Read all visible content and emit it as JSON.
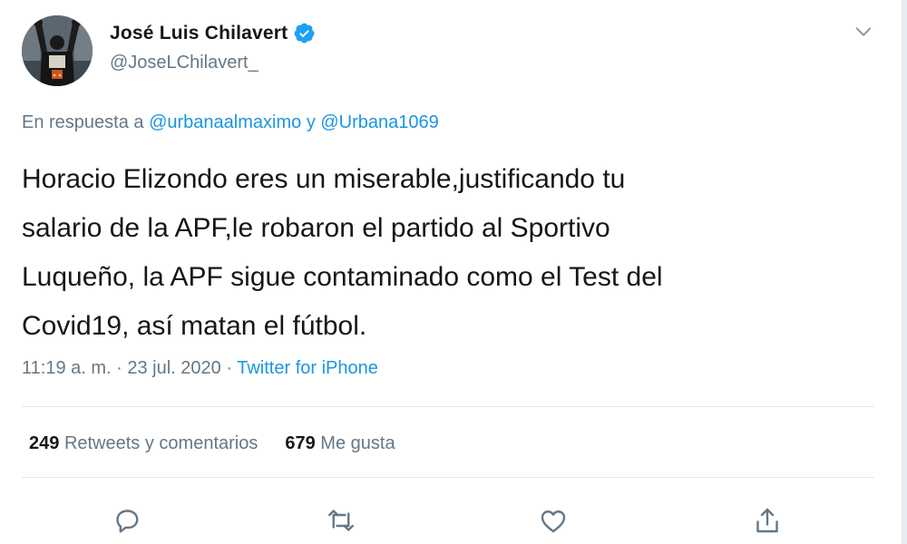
{
  "user": {
    "display_name": "José Luis Chilavert",
    "handle": "@JoseLChilavert_",
    "verified": true
  },
  "reply": {
    "prefix": "En respuesta a",
    "mention_1": "@urbanaalmaximo",
    "connector": "y",
    "mention_2": "@Urbana1069"
  },
  "tweet": {
    "text": "Horacio Elizondo eres un miserable,justificando tu\nsalario de la APF,le robaron el partido al Sportivo\nLuqueño, la APF sigue contaminado como el Test del\nCovid19, así matan el fútbol."
  },
  "meta": {
    "time": "11:19 a. m.",
    "separator": "·",
    "date": "23 jul. 2020",
    "source": "Twitter for iPhone"
  },
  "stats": {
    "retweets_count": "249",
    "retweets_label": "Retweets y comentarios",
    "likes_count": "679",
    "likes_label": "Me gusta"
  },
  "actions": [
    "reply-icon",
    "retweet-icon",
    "like-icon",
    "share-icon"
  ],
  "colors": {
    "link": "#1b95e0",
    "secondary_text": "#657786",
    "primary_text": "#14171a",
    "divider": "#e1e8ed",
    "verified": "#1da1f2"
  }
}
